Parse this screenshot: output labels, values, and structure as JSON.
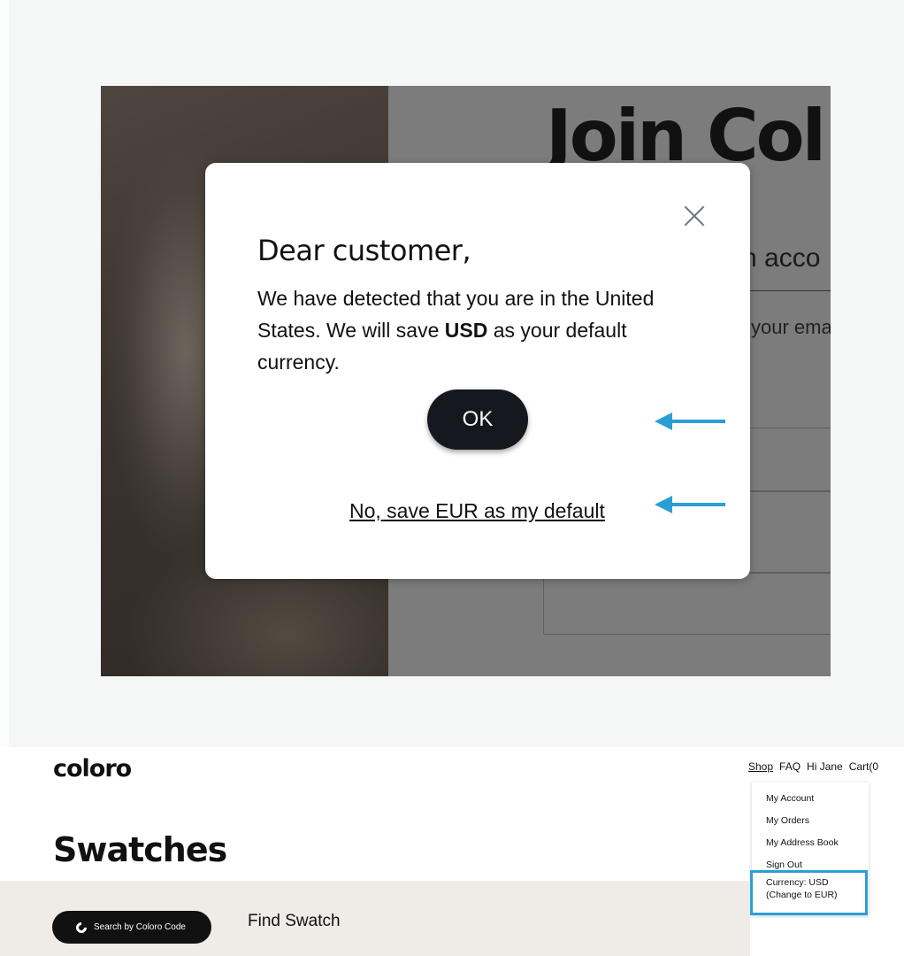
{
  "signup_page": {
    "title": "Join Col",
    "subtitle": "n acco",
    "email_hint": "your ema"
  },
  "modal": {
    "title": "Dear customer,",
    "body_before": "We have detected that you are in the United States. We will save ",
    "body_bold": "USD",
    "body_after": " as your default currency.",
    "ok_label": "OK",
    "eur_link": "No, save EUR as my default"
  },
  "header": {
    "logo": "coloro",
    "nav": {
      "shop": "Shop",
      "faq": "FAQ",
      "greeting": "Hi Jane",
      "cart": "Cart(0"
    }
  },
  "account_menu": {
    "items": [
      "My Account",
      "My Orders",
      "My Address Book",
      "Sign Out"
    ],
    "currency_line1": "Currency: USD",
    "currency_line2": "(Change to EUR)"
  },
  "page": {
    "title": "Swatches",
    "search_button": "Search by Coloro Code",
    "find_swatch": "Find Swatch"
  },
  "colors": {
    "annotation_arrow": "#2a9fd5",
    "ok_button": "#16181f",
    "band": "#efebe7"
  }
}
